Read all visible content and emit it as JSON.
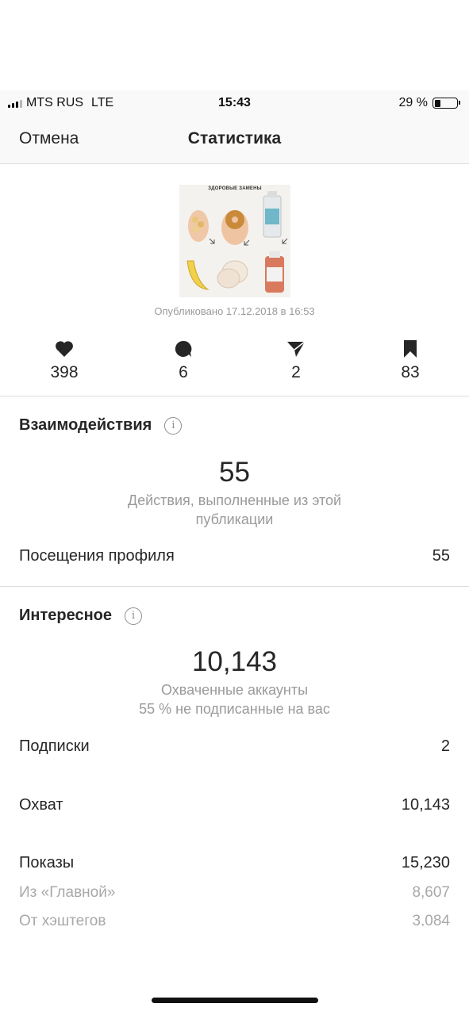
{
  "status_bar": {
    "carrier": "MTS RUS",
    "network": "LTE",
    "time": "15:43",
    "battery_percent": "29 %",
    "battery_level": 0.29
  },
  "nav": {
    "cancel_label": "Отмена",
    "title": "Статистика"
  },
  "post": {
    "image_title": "ЗДОРОВЫЕ ЗАМЕНЫ",
    "published": "Опубликовано 17.12.2018 в 16:53"
  },
  "metrics": {
    "likes": "398",
    "comments": "6",
    "shares": "2",
    "saves": "83"
  },
  "interactions": {
    "title": "Взаимодействия",
    "total": "55",
    "description_line1": "Действия, выполненные из этой",
    "description_line2": "публикации",
    "profile_visits_label": "Посещения профиля",
    "profile_visits_value": "55"
  },
  "discovery": {
    "title": "Интересное",
    "reach_total": "10,143",
    "reach_label": "Охваченные аккаунты",
    "not_following_note": "55 % не подписанные на вас",
    "rows": [
      {
        "label": "Подписки",
        "value": "2"
      },
      {
        "label": "Охват",
        "value": "10,143"
      },
      {
        "label": "Показы",
        "value": "15,230"
      }
    ],
    "sub_rows": [
      {
        "label": "Из «Главной»",
        "value": "8,607"
      },
      {
        "label": "От хэштегов",
        "value": "3,084"
      }
    ]
  }
}
